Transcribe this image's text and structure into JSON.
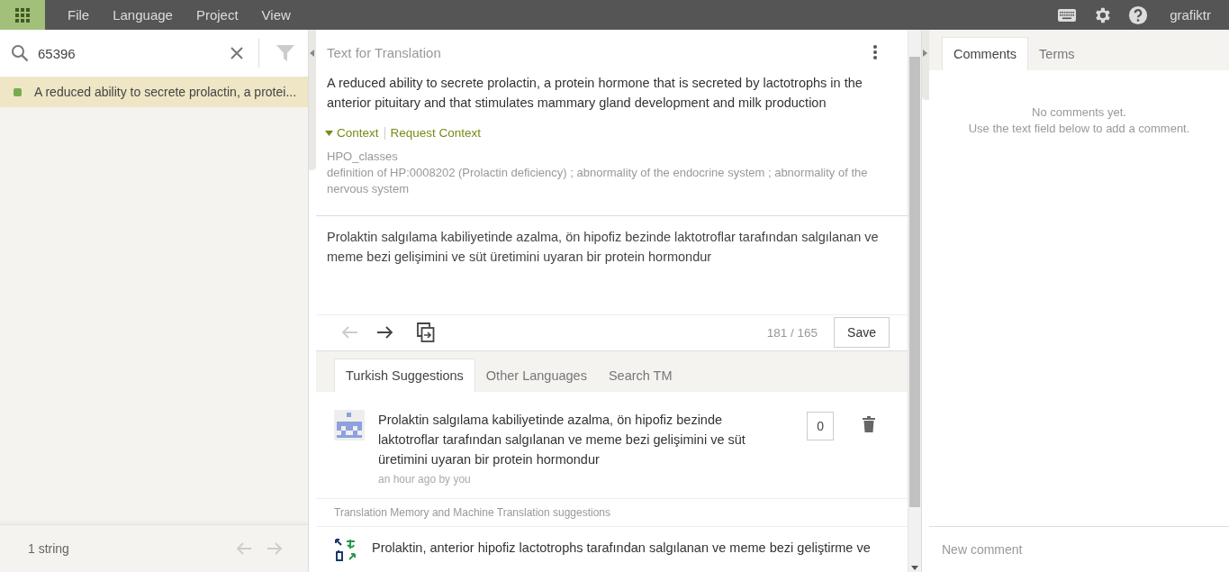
{
  "menu": [
    "File",
    "Language",
    "Project",
    "View"
  ],
  "user": "grafiktr",
  "search": {
    "value": "65396"
  },
  "strings": [
    {
      "text": "A reduced ability to secrete prolactin, a protei...",
      "selected": true,
      "color": "#77ab4f"
    }
  ],
  "strings_footer": {
    "count": "1 string",
    "prev_disabled": true,
    "next_disabled": true
  },
  "editor": {
    "title": "Text for Translation",
    "source": "A reduced ability to secrete prolactin, a protein hormone that is secreted by lactotrophs in the anterior pituitary and that stimulates mammary gland development and milk production",
    "context_toggle": "Context",
    "context_expanded": true,
    "request_context": "Request Context",
    "context_lines": [
      "HPO_classes",
      "definition of HP:0008202 (Prolactin deficiency) ; abnormality of the endocrine system ; abnormality of the nervous system"
    ],
    "translation": "Prolaktin salgılama kabiliyetinde azalma, ön hipofiz bezinde laktotroflar tarafından salgılanan ve meme bezi gelişimini ve süt üretimini uyaran bir protein hormondur",
    "prev_disabled": true,
    "next_disabled": false,
    "counter": "181 / 165",
    "save": "Save"
  },
  "suggestion_tabs": [
    {
      "label": "Turkish Suggestions",
      "selected": true
    },
    {
      "label": "Other Languages",
      "selected": false
    },
    {
      "label": "Search TM",
      "selected": false
    }
  ],
  "suggestions": [
    {
      "text": "Prolaktin salgılama kabiliyetinde azalma, ön hipofiz bezinde laktotroflar tarafından salgılanan ve meme bezi gelişimini ve süt üretimini uyaran bir protein hormondur",
      "meta": "an hour ago by you",
      "votes": "0"
    }
  ],
  "tm_header": "Translation Memory and Machine Translation suggestions",
  "tm_suggestions": [
    {
      "text": "Prolaktin, anterior hipofiz lactotrophs tarafından salgılanan ve meme bezi geliştirme ve"
    }
  ],
  "side_tabs": [
    {
      "label": "Comments",
      "selected": true
    },
    {
      "label": "Terms",
      "selected": false
    }
  ],
  "comments_empty": [
    "No comments yet.",
    "Use the text field below to add a comment."
  ],
  "new_comment": {
    "placeholder": "New comment"
  }
}
